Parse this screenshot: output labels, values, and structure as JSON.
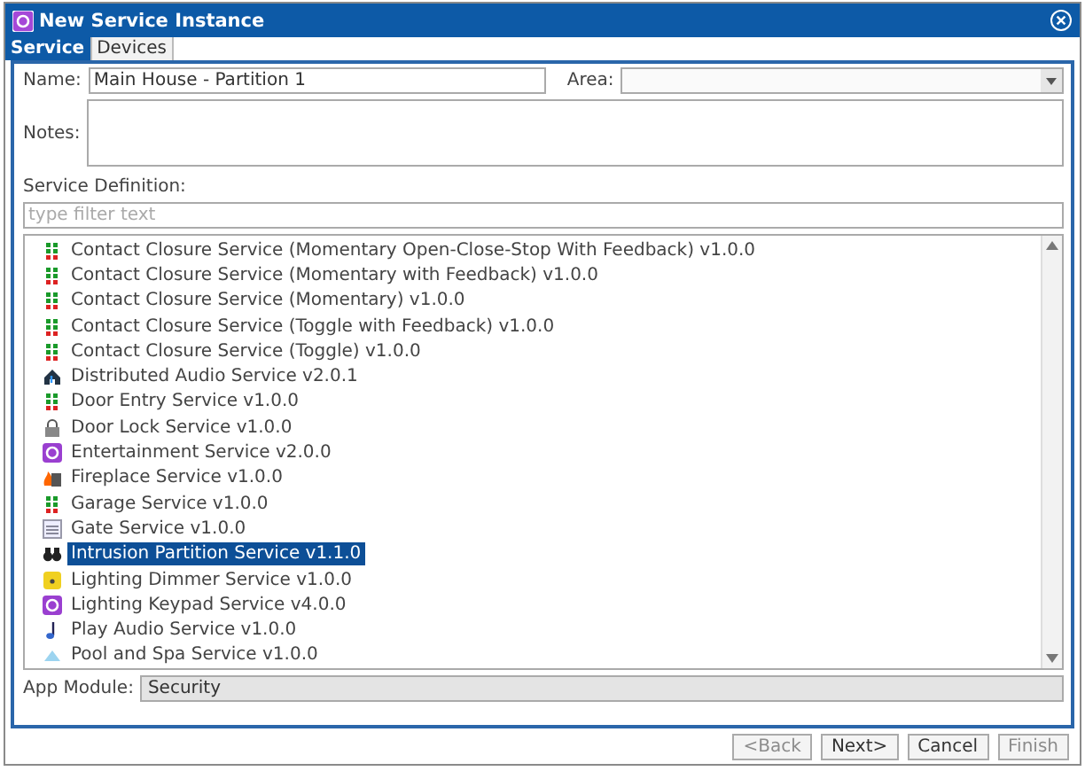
{
  "window": {
    "title": "New Service Instance"
  },
  "tabs": [
    {
      "label": "Service",
      "selected": true
    },
    {
      "label": "Devices",
      "selected": false
    }
  ],
  "name_field": {
    "label": "Name:",
    "value": "Main House - Partition 1"
  },
  "area_field": {
    "label": "Area:"
  },
  "notes_field": {
    "label": "Notes:"
  },
  "service_definition": {
    "label": "Service Definition:",
    "filter_placeholder": "type filter text",
    "items": [
      {
        "kind": "contact",
        "label": "Contact Closure Service (Momentary Open-Close-Stop With Feedback) v1.0.0",
        "selected": false
      },
      {
        "kind": "contact",
        "label": "Contact Closure Service (Momentary with Feedback) v1.0.0",
        "selected": false
      },
      {
        "kind": "contact",
        "label": "Contact Closure Service (Momentary) v1.0.0",
        "selected": false
      },
      {
        "kind": "contact",
        "label": "Contact Closure Service (Toggle with Feedback) v1.0.0",
        "selected": false
      },
      {
        "kind": "contact",
        "label": "Contact Closure Service (Toggle) v1.0.0",
        "selected": false
      },
      {
        "kind": "audio",
        "label": "Distributed Audio Service v2.0.1",
        "selected": false
      },
      {
        "kind": "contact",
        "label": "Door Entry Service v1.0.0",
        "selected": false
      },
      {
        "kind": "lock",
        "label": "Door Lock Service v1.0.0",
        "selected": false
      },
      {
        "kind": "gear",
        "label": "Entertainment Service v2.0.0",
        "selected": false
      },
      {
        "kind": "fire",
        "label": "Fireplace Service v1.0.0",
        "selected": false
      },
      {
        "kind": "contact",
        "label": "Garage Service v1.0.0",
        "selected": false
      },
      {
        "kind": "gate",
        "label": "Gate Service v1.0.0",
        "selected": false
      },
      {
        "kind": "intrusion",
        "label": "Intrusion Partition Service v1.1.0",
        "selected": true
      },
      {
        "kind": "dimmer",
        "label": "Lighting Dimmer Service v1.0.0",
        "selected": false
      },
      {
        "kind": "gear",
        "label": "Lighting Keypad Service v4.0.0",
        "selected": false
      },
      {
        "kind": "note",
        "label": "Play Audio Service v1.0.0",
        "selected": false
      },
      {
        "kind": "pool",
        "label": "Pool and Spa Service v1.0.0",
        "selected": false
      }
    ]
  },
  "app_module": {
    "label": "App Module:",
    "value": "Security"
  },
  "buttons": [
    {
      "label": "<Back",
      "disabled": true
    },
    {
      "label": "Next>",
      "disabled": false
    },
    {
      "label": "Cancel",
      "disabled": false
    },
    {
      "label": "Finish",
      "disabled": true
    }
  ]
}
